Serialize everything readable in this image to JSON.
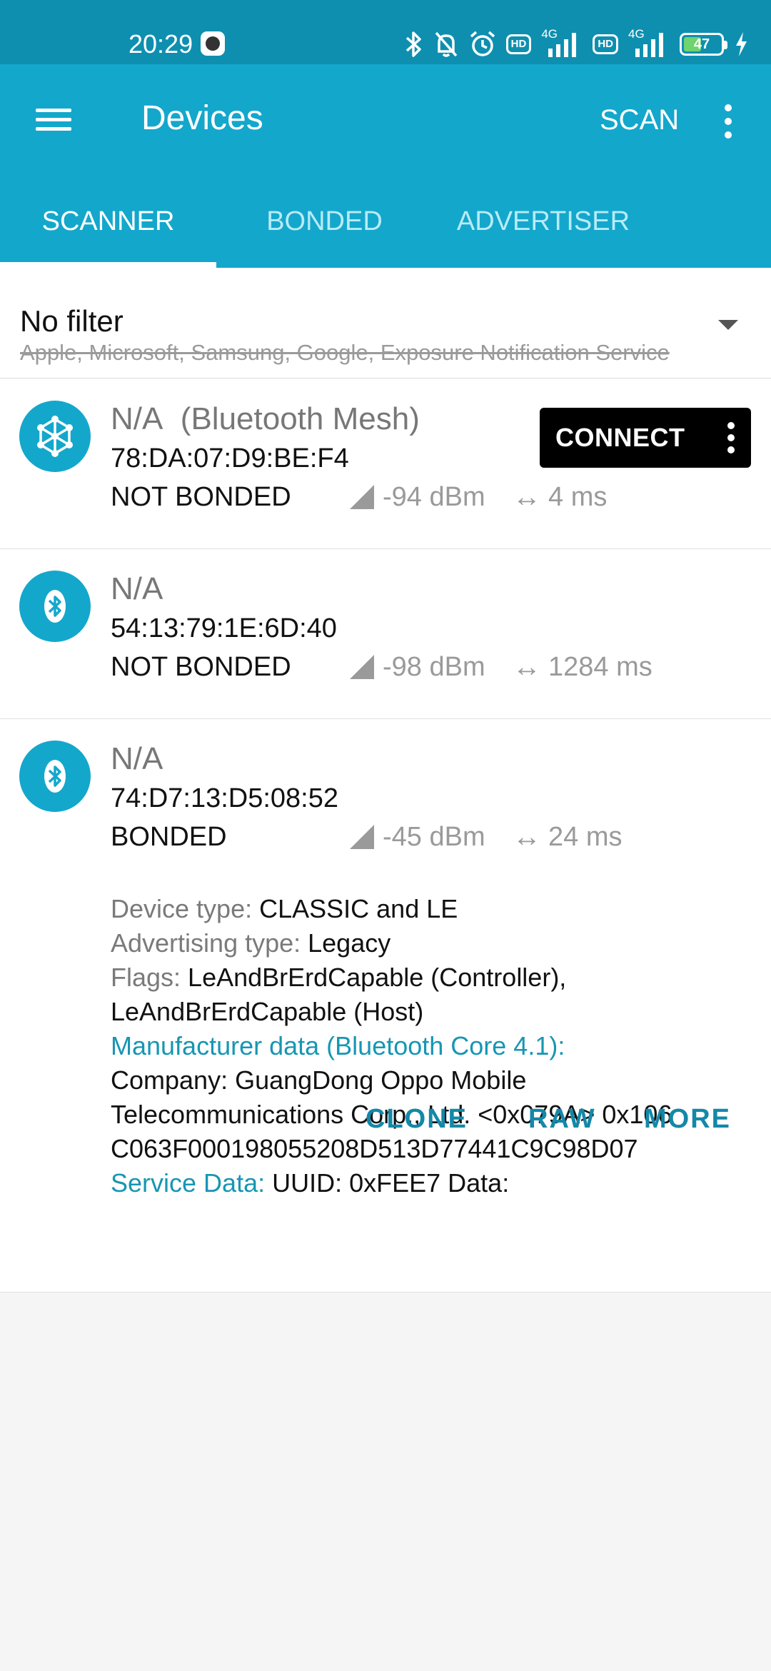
{
  "status_bar": {
    "time": "20:29",
    "network_1": "4G",
    "network_2": "4G",
    "hd_1": "HD",
    "hd_2": "HD",
    "battery": "47",
    "battery_level": 0.47,
    "battery_color": "#6fd36f"
  },
  "app_bar": {
    "title": "Devices",
    "scan_label": "SCAN",
    "color": "#14a7cc"
  },
  "tabs": [
    {
      "label": "SCANNER",
      "active": true
    },
    {
      "label": "BONDED",
      "active": false
    },
    {
      "label": "ADVERTISER",
      "active": false
    }
  ],
  "filter": {
    "title": "No filter",
    "excluded": "Apple, Microsoft, Samsung, Google, Exposure Notification Service"
  },
  "devices": [
    {
      "name": "N/A  (Bluetooth Mesh)",
      "address": "78:DA:07:D9:BE:F4",
      "bond_state": "NOT BONDED",
      "rssi": "-94 dBm",
      "interval": "4 ms",
      "icon": "mesh-icon",
      "connect_label": "CONNECT"
    },
    {
      "name": "N/A",
      "address": "54:13:79:1E:6D:40",
      "bond_state": "NOT BONDED",
      "rssi": "-98 dBm",
      "interval": "1284 ms",
      "icon": "bluetooth-icon"
    },
    {
      "name": "N/A",
      "address": "74:D7:13:D5:08:52",
      "bond_state": "BONDED",
      "rssi": "-45 dBm",
      "interval": "24 ms",
      "icon": "bluetooth-icon",
      "details": {
        "device_type_label": "Device type: ",
        "device_type": "CLASSIC and LE",
        "adv_type_label": "Advertising type: ",
        "adv_type": "Legacy",
        "flags_label": "Flags: ",
        "flags_line1": "LeAndBrErdCapable (Controller),",
        "flags_line2": "LeAndBrErdCapable (Host)",
        "manufacturer_label": "Manufacturer data (Bluetooth Core 4.1):",
        "company_line1": "Company: GuangDong Oppo Mobile",
        "company_line2": "Telecommunications Corp., Ltd. <0x079A> 0x106",
        "company_line3": "C063F000198055208D513D77441C9C98D07",
        "service_data_label": "Service Data: ",
        "service_data": "UUID: 0xFEE7 Data:"
      },
      "actions": [
        "CLONE",
        "RAW",
        "MORE"
      ]
    }
  ]
}
